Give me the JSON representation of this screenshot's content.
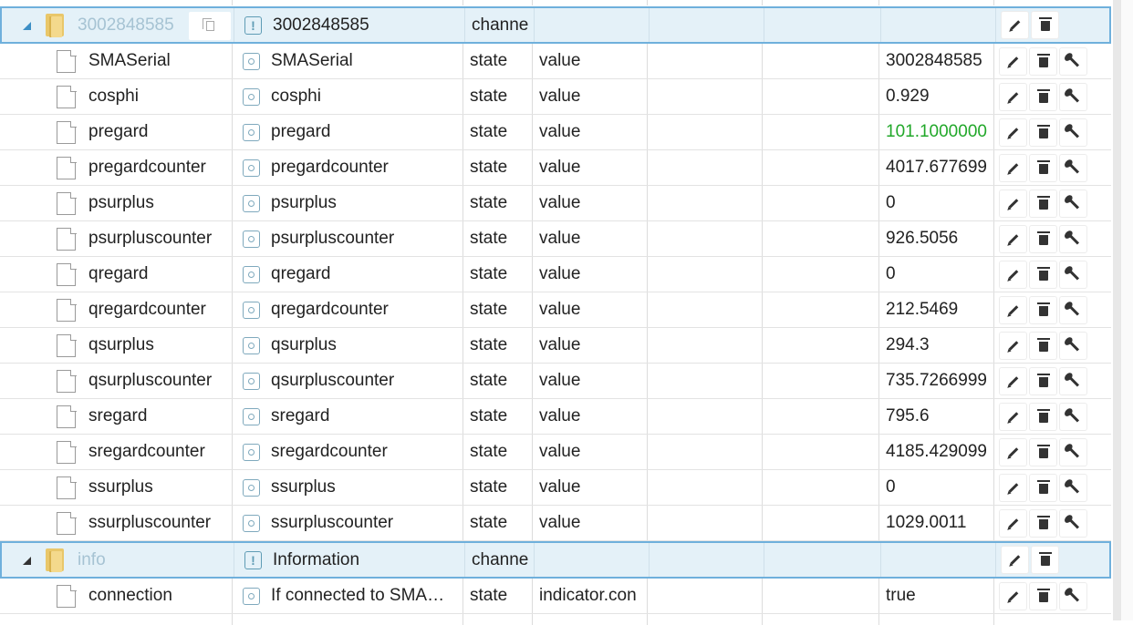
{
  "channels": [
    {
      "id": "3002848585",
      "name": "3002848585",
      "type": "channe"
    },
    {
      "id": "info",
      "name": "Information",
      "type": "channe"
    }
  ],
  "states": [
    {
      "id": "SMASerial",
      "name": "SMASerial",
      "type": "state",
      "role": "value",
      "value": "3002848585"
    },
    {
      "id": "cosphi",
      "name": "cosphi",
      "type": "state",
      "role": "value",
      "value": "0.929"
    },
    {
      "id": "pregard",
      "name": "pregard",
      "type": "state",
      "role": "value",
      "value": "101.1000000"
    },
    {
      "id": "pregardcounter",
      "name": "pregardcounter",
      "type": "state",
      "role": "value",
      "value": "4017.677699"
    },
    {
      "id": "psurplus",
      "name": "psurplus",
      "type": "state",
      "role": "value",
      "value": "0"
    },
    {
      "id": "psurpluscounter",
      "name": "psurpluscounter",
      "type": "state",
      "role": "value",
      "value": "926.5056"
    },
    {
      "id": "qregard",
      "name": "qregard",
      "type": "state",
      "role": "value",
      "value": "0"
    },
    {
      "id": "qregardcounter",
      "name": "qregardcounter",
      "type": "state",
      "role": "value",
      "value": "212.5469"
    },
    {
      "id": "qsurplus",
      "name": "qsurplus",
      "type": "state",
      "role": "value",
      "value": "294.3"
    },
    {
      "id": "qsurpluscounter",
      "name": "qsurpluscounter",
      "type": "state",
      "role": "value",
      "value": "735.7266999"
    },
    {
      "id": "sregard",
      "name": "sregard",
      "type": "state",
      "role": "value",
      "value": "795.6"
    },
    {
      "id": "sregardcounter",
      "name": "sregardcounter",
      "type": "state",
      "role": "value",
      "value": "4185.429099"
    },
    {
      "id": "ssurplus",
      "name": "ssurplus",
      "type": "state",
      "role": "value",
      "value": "0"
    },
    {
      "id": "ssurpluscounter",
      "name": "ssurpluscounter",
      "type": "state",
      "role": "value",
      "value": "1029.0011"
    },
    {
      "id": "connection",
      "name": "If connected to SMA…",
      "type": "state",
      "role": "indicator.con",
      "value": "true"
    }
  ],
  "colors": {
    "changed_value": "#22a82a",
    "selected_row": "#e4f1f8",
    "selected_border": "#6fb0dc"
  },
  "icons": {
    "edit": "pencil-icon",
    "delete": "trash-icon",
    "custom": "wrench-icon",
    "copy": "copy-icon"
  }
}
